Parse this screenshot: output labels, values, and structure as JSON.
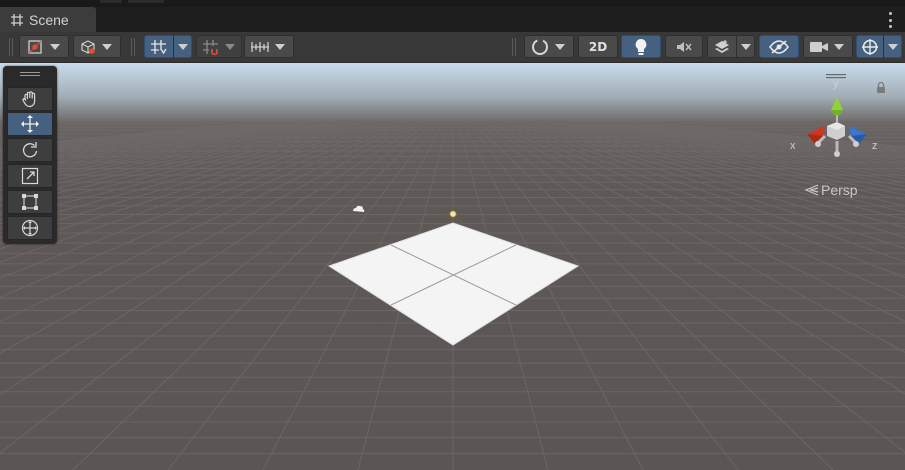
{
  "tab": {
    "label": "Scene",
    "icon": "grid-icon"
  },
  "toolbar": {
    "left_buttons": [
      "gizmo-tool-icon",
      "draw-mode-icon",
      "grid-snap-icon",
      "increment-snap-icon",
      "snap-ruler-icon"
    ],
    "right_buttons": [
      "shading-icon",
      "2d-toggle",
      "lighting-icon",
      "audio-mute-icon",
      "effects-icon",
      "scene-visibility-icon",
      "camera-icon",
      "gizmos-icon"
    ],
    "mode_2d_label": "2D"
  },
  "tools": [
    "hand-tool",
    "move-tool",
    "rotate-tool",
    "scale-tool",
    "rect-tool",
    "transform-tool"
  ],
  "active_tool": "move-tool",
  "gizmo": {
    "x_label": "x",
    "y_label": "y",
    "z_label": "z",
    "projection_label": "Persp"
  },
  "colors": {
    "x_axis": "#d1351d",
    "y_axis": "#8ed33a",
    "z_axis": "#3a75cf",
    "sky": "#c6dbeb",
    "ground": "#5d5756",
    "accent": "#46607f"
  }
}
